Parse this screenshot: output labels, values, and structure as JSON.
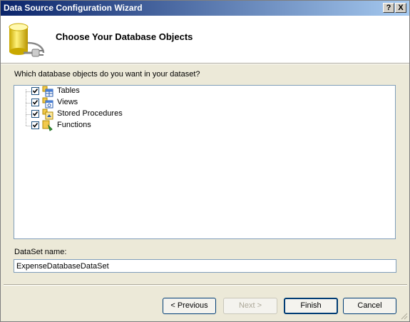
{
  "window": {
    "title": "Data Source Configuration Wizard"
  },
  "titlebar_buttons": {
    "help": "?",
    "close": "X"
  },
  "header": {
    "heading": "Choose Your Database Objects",
    "icon": "database-plug-icon"
  },
  "prompt": "Which database objects do you want in your dataset?",
  "tree": [
    {
      "label": "Tables",
      "checked": true,
      "icon": "tables-icon"
    },
    {
      "label": "Views",
      "checked": true,
      "icon": "views-icon"
    },
    {
      "label": "Stored Procedures",
      "checked": true,
      "icon": "stored-procedures-icon"
    },
    {
      "label": "Functions",
      "checked": true,
      "icon": "functions-icon"
    }
  ],
  "dataset": {
    "label": "DataSet name:",
    "value": "ExpenseDatabaseDataSet"
  },
  "buttons": {
    "previous": "< Previous",
    "next": "Next >",
    "finish": "Finish",
    "cancel": "Cancel"
  }
}
